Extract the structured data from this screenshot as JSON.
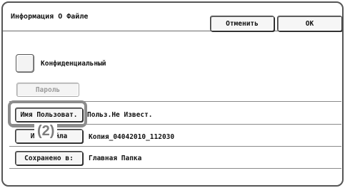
{
  "window": {
    "title": "Информация О Файле"
  },
  "header": {
    "cancel_label": "Отменить",
    "ok_label": "OK"
  },
  "confidential": {
    "label": "Конфиденциальный"
  },
  "password": {
    "label": "Пароль"
  },
  "rows": [
    {
      "button_label": "Имя Пользоват.",
      "value": "Польз.Не Извест."
    },
    {
      "button_label": "Имя Файла",
      "value": "Копия_04042010_112030"
    },
    {
      "button_label": "Сохранено в:",
      "value": "Главная Папка"
    }
  ],
  "annotation": {
    "callout_text": "(2)"
  },
  "colors": {
    "highlight": "#8c8c8c",
    "frame_border": "#555555",
    "background": "#ffffff"
  }
}
